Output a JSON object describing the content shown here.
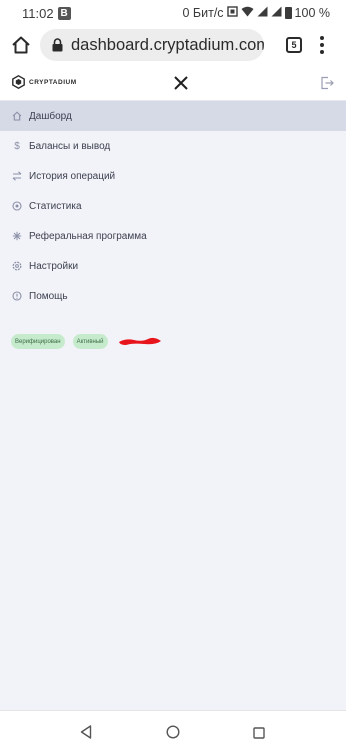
{
  "status": {
    "time": "11:02",
    "notification_badge": "B",
    "net_speed": "0 Бит/с",
    "battery": "100 %"
  },
  "browser": {
    "url": "dashboard.cryptadium.com,",
    "tab_count": "5"
  },
  "brand": {
    "name": "CRYPTADIUM"
  },
  "menu": {
    "items": [
      {
        "label": "Дашборд",
        "icon": "home-icon",
        "active": true
      },
      {
        "label": "Балансы и вывод",
        "icon": "dollar-icon",
        "active": false
      },
      {
        "label": "История операций",
        "icon": "swap-icon",
        "active": false
      },
      {
        "label": "Статистика",
        "icon": "stats-icon",
        "active": false
      },
      {
        "label": "Реферальная программа",
        "icon": "referral-icon",
        "active": false
      },
      {
        "label": "Настройки",
        "icon": "settings-icon",
        "active": false
      },
      {
        "label": "Помощь",
        "icon": "help-icon",
        "active": false
      }
    ]
  },
  "badges": {
    "verified": "Верифицирован",
    "active": "Активный"
  },
  "colors": {
    "background": "#f2f3f8",
    "active_item": "#d6d9e6",
    "badge_bg": "#c6ebcc",
    "badge_text": "#3b6b45",
    "redaction": "#e8141c"
  }
}
